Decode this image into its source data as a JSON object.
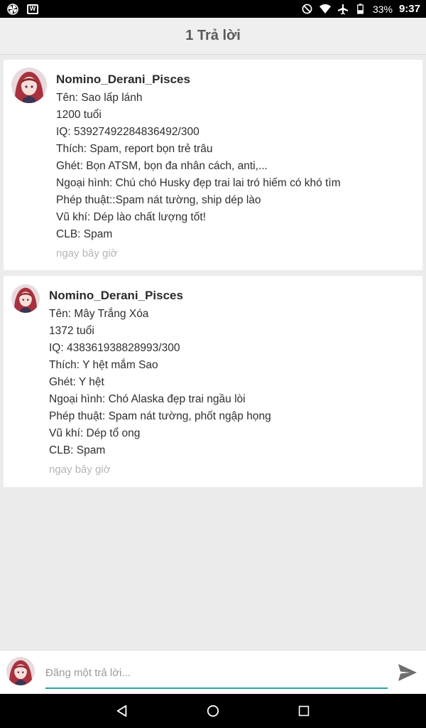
{
  "status_bar": {
    "icons": [
      "pinwheel-icon",
      "w-app-icon",
      "do-not-disturb-icon",
      "wifi-icon",
      "airplane-icon",
      "battery-icon"
    ],
    "battery": "33%",
    "time": "9:37"
  },
  "header": {
    "title": "1 Trả lời"
  },
  "comments": [
    {
      "username": "Nomino_Derani_Pisces",
      "lines": [
        "Tên: Sao lấp lánh",
        "1200 tuổi",
        "IQ: 53927492284836492/300",
        "Thích: Spam, report bọn trẻ trâu",
        "Ghét: Bọn ATSM, bọn đa nhân cách, anti,...",
        "Ngoại hình: Chú chó Husky đẹp trai lai tró hiếm có khó tìm",
        "Phép thuật::Spam nát tường, ship dép lào",
        "Vũ khí: Dép lào chất lượng tốt!",
        "CLB: Spam"
      ],
      "time": "ngay bây giờ"
    },
    {
      "username": "Nomino_Derani_Pisces",
      "lines": [
        "Tên: Mây Trắng Xóa",
        "1372 tuổi",
        "IQ: 438361938828993/300",
        "Thích: Y hệt mắm Sao",
        "Ghét: Y hệt",
        "Ngoại hình: Chó Alaska đẹp trai ngầu lòi",
        "Phép thuật: Spam nát tường, phốt ngập họng",
        "Vũ khí: Dép tổ ong",
        "CLB: Spam"
      ],
      "time": "ngay bây giờ"
    }
  ],
  "reply": {
    "placeholder": "Đăng một trả lời..."
  },
  "nav": {
    "icons": [
      "back-icon",
      "home-icon",
      "recents-icon"
    ]
  },
  "colors": {
    "accent": "#2aa3a3",
    "header_bg": "#efefef",
    "page_bg": "#ececec"
  }
}
